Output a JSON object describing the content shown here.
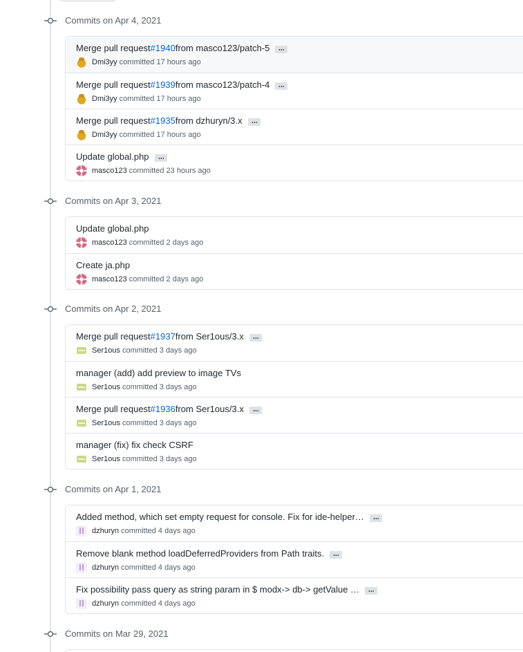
{
  "groups": [
    {
      "title": "Commits on Apr 4, 2021",
      "commits": [
        {
          "prefix": "Merge pull request ",
          "pr": "#1940",
          "suffix": " from masco123/patch-5",
          "author": "Dmi3yy",
          "time": "committed 17 hours ago",
          "avatar": "dmi3yy-avatar"
        },
        {
          "prefix": "Merge pull request ",
          "pr": "#1939",
          "suffix": " from masco123/patch-4",
          "author": "Dmi3yy",
          "time": "committed 17 hours ago",
          "avatar": "dmi3yy-avatar"
        },
        {
          "prefix": "Merge pull request ",
          "pr": "#1935",
          "suffix": " from dzhuryn/3.x",
          "author": "Dmi3yy",
          "time": "committed 17 hours ago",
          "avatar": "dmi3yy-avatar"
        },
        {
          "prefix": "Update global.php",
          "pr": "",
          "suffix": "",
          "author": "masco123",
          "time": "committed 23 hours ago",
          "avatar": "masco123-avatar"
        }
      ]
    },
    {
      "title": "Commits on Apr 3, 2021",
      "commits": [
        {
          "prefix": "Update global.php",
          "pr": "",
          "suffix": "",
          "author": "masco123",
          "time": "committed 2 days ago",
          "avatar": "masco123-avatar"
        },
        {
          "prefix": "Create ja.php",
          "pr": "",
          "suffix": "",
          "author": "masco123",
          "time": "committed 2 days ago",
          "avatar": "masco123-avatar"
        }
      ]
    },
    {
      "title": "Commits on Apr 2, 2021",
      "commits": [
        {
          "prefix": "Merge pull request ",
          "pr": "#1937",
          "suffix": " from Ser1ous/3.x",
          "author": "Ser1ous",
          "time": "committed 3 days ago",
          "avatar": "ser1ous-avatar"
        },
        {
          "prefix": "manager (add) add preview to image TVs",
          "pr": "",
          "suffix": "",
          "author": "Ser1ous",
          "time": "committed 3 days ago",
          "avatar": "ser1ous-avatar"
        },
        {
          "prefix": "Merge pull request ",
          "pr": "#1936",
          "suffix": " from Ser1ous/3.x",
          "author": "Ser1ous",
          "time": "committed 3 days ago",
          "avatar": "ser1ous-avatar"
        },
        {
          "prefix": "manager (fix) fix check CSRF",
          "pr": "",
          "suffix": "",
          "author": "Ser1ous",
          "time": "committed 3 days ago",
          "avatar": "ser1ous-avatar"
        }
      ]
    },
    {
      "title": "Commits on Apr 1, 2021",
      "commits": [
        {
          "prefix": "Added method, which set empty request for console. Fix for ide-helper…",
          "pr": "",
          "suffix": "",
          "author": "dzhuryn",
          "time": "committed 4 days ago",
          "avatar": "dzhuryn-avatar"
        },
        {
          "prefix": "Remove blank method loadDeferredProviders from Path traits.",
          "pr": "",
          "suffix": "",
          "author": "dzhuryn",
          "time": "committed 4 days ago",
          "avatar": "dzhuryn-avatar"
        },
        {
          "prefix": "Fix possibility pass query as string param in $ modx-> db-> getValue …",
          "pr": "",
          "suffix": "",
          "author": "dzhuryn",
          "time": "committed 4 days ago",
          "avatar": "dzhuryn-avatar"
        }
      ]
    },
    {
      "title": "Commits on Mar 29, 2021",
      "commits": []
    }
  ]
}
